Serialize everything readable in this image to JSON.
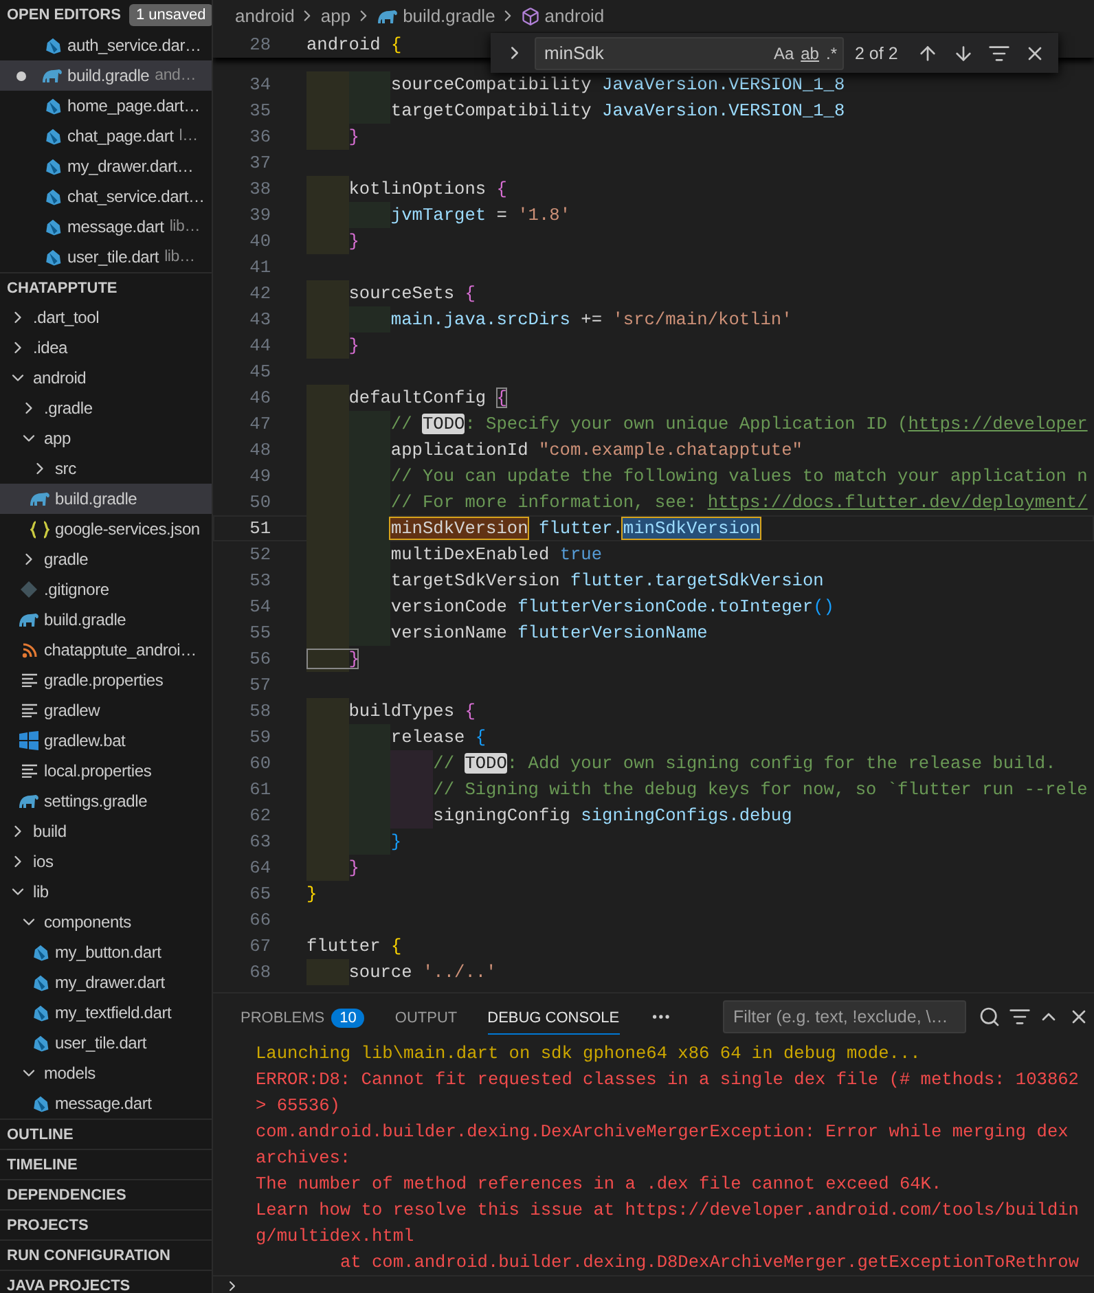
{
  "open_editors": {
    "title": "OPEN EDITORS",
    "badge": "1 unsaved",
    "items": [
      {
        "name": "auth_service.dar…",
        "kind": "dart",
        "selected": false,
        "unsaved": false
      },
      {
        "name": "build.gradle",
        "description": "and…",
        "kind": "gradle",
        "selected": true,
        "unsaved": true
      },
      {
        "name": "home_page.dart…",
        "kind": "dart",
        "selected": false,
        "unsaved": false
      },
      {
        "name": "chat_page.dart",
        "description": "l…",
        "kind": "dart",
        "selected": false,
        "unsaved": false
      },
      {
        "name": "my_drawer.dart…",
        "kind": "dart",
        "selected": false,
        "unsaved": false
      },
      {
        "name": "chat_service.dart…",
        "kind": "dart",
        "selected": false,
        "unsaved": false
      },
      {
        "name": "message.dart",
        "description": "lib…",
        "kind": "dart",
        "selected": false,
        "unsaved": false
      },
      {
        "name": "user_tile.dart",
        "description": "lib…",
        "kind": "dart",
        "selected": false,
        "unsaved": false
      }
    ]
  },
  "explorer": {
    "title": "CHATAPPTUTE",
    "tree": [
      {
        "name": ".dart_tool",
        "kind": "folder",
        "expanded": false,
        "selected": false
      },
      {
        "name": ".idea",
        "kind": "folder",
        "expanded": false,
        "selected": false
      },
      {
        "name": "android",
        "kind": "folder",
        "expanded": true,
        "selected": false,
        "children": [
          {
            "name": ".gradle",
            "kind": "folder",
            "expanded": false,
            "selected": false
          },
          {
            "name": "app",
            "kind": "folder",
            "expanded": true,
            "selected": false,
            "children": [
              {
                "name": "src",
                "kind": "folder",
                "expanded": false,
                "selected": false
              },
              {
                "name": "build.gradle",
                "kind": "gradle",
                "selected": true
              },
              {
                "name": "google-services.json",
                "kind": "json",
                "selected": false
              }
            ]
          },
          {
            "name": "gradle",
            "kind": "folder",
            "expanded": false,
            "selected": false
          },
          {
            "name": ".gitignore",
            "kind": "git",
            "selected": false
          },
          {
            "name": "build.gradle",
            "kind": "gradle",
            "selected": false
          },
          {
            "name": "chatapptute_androi…",
            "kind": "feed",
            "selected": false
          },
          {
            "name": "gradle.properties",
            "kind": "text",
            "selected": false
          },
          {
            "name": "gradlew",
            "kind": "text",
            "selected": false
          },
          {
            "name": "gradlew.bat",
            "kind": "windows",
            "selected": false
          },
          {
            "name": "local.properties",
            "kind": "text",
            "selected": false
          },
          {
            "name": "settings.gradle",
            "kind": "gradle",
            "selected": false
          }
        ]
      },
      {
        "name": "build",
        "kind": "folder",
        "expanded": false,
        "selected": false
      },
      {
        "name": "ios",
        "kind": "folder",
        "expanded": false,
        "selected": false
      },
      {
        "name": "lib",
        "kind": "folder",
        "expanded": true,
        "selected": false,
        "children": [
          {
            "name": "components",
            "kind": "folder",
            "expanded": true,
            "selected": false,
            "children": [
              {
                "name": "my_button.dart",
                "kind": "dart",
                "selected": false
              },
              {
                "name": "my_drawer.dart",
                "kind": "dart",
                "selected": false
              },
              {
                "name": "my_textfield.dart",
                "kind": "dart",
                "selected": false
              },
              {
                "name": "user_tile.dart",
                "kind": "dart",
                "selected": false
              }
            ]
          },
          {
            "name": "models",
            "kind": "folder",
            "expanded": true,
            "selected": false,
            "children": [
              {
                "name": "message.dart",
                "kind": "dart",
                "selected": false
              }
            ]
          }
        ]
      }
    ]
  },
  "sections": [
    "OUTLINE",
    "TIMELINE",
    "DEPENDENCIES",
    "PROJECTS",
    "RUN CONFIGURATION",
    "JAVA PROJECTS"
  ],
  "breadcrumb": [
    {
      "kind": "folder",
      "text": "android"
    },
    {
      "kind": "folder",
      "text": "app"
    },
    {
      "kind": "gradle",
      "text": "build.gradle"
    },
    {
      "kind": "module",
      "text": "android"
    }
  ],
  "find": {
    "value": "minSdk",
    "options": [
      "Aa",
      "ab",
      ".*"
    ],
    "count": "2 of 2"
  },
  "sticky": {
    "number": "28",
    "tokens": [
      {
        "kind": "plain",
        "text": "android "
      },
      {
        "kind": "brace1",
        "text": "{"
      }
    ]
  },
  "lines": [
    {
      "number": "34",
      "current": false,
      "tokens": [
        {
          "kind": "plain",
          "text": "        sourceCompatibility "
        },
        {
          "kind": "var",
          "text": "JavaVersion.VERSION_1_8"
        }
      ]
    },
    {
      "number": "35",
      "current": false,
      "tokens": [
        {
          "kind": "plain",
          "text": "        targetCompatibility "
        },
        {
          "kind": "var",
          "text": "JavaVersion.VERSION_1_8"
        }
      ]
    },
    {
      "number": "36",
      "current": false,
      "tokens": [
        {
          "kind": "brace2",
          "text": "    }"
        }
      ]
    },
    {
      "number": "37",
      "current": false
    },
    {
      "number": "38",
      "current": false,
      "tokens": [
        {
          "kind": "plain",
          "text": "    kotlinOptions "
        },
        {
          "kind": "brace2",
          "text": "{"
        }
      ]
    },
    {
      "number": "39",
      "current": false,
      "tokens": [
        {
          "kind": "var",
          "text": "        jvmTarget"
        },
        {
          "kind": "plain",
          "text": " = "
        },
        {
          "kind": "str",
          "text": "'1.8'"
        }
      ]
    },
    {
      "number": "40",
      "current": false,
      "tokens": [
        {
          "kind": "brace2",
          "text": "    }"
        }
      ]
    },
    {
      "number": "41",
      "current": false
    },
    {
      "number": "42",
      "current": false,
      "tokens": [
        {
          "kind": "plain",
          "text": "    sourceSets "
        },
        {
          "kind": "brace2",
          "text": "{"
        }
      ]
    },
    {
      "number": "43",
      "current": false,
      "tokens": [
        {
          "kind": "var",
          "text": "        main.java.srcDirs"
        },
        {
          "kind": "plain",
          "text": " += "
        },
        {
          "kind": "str",
          "text": "'src/main/kotlin'"
        }
      ]
    },
    {
      "number": "44",
      "current": false,
      "tokens": [
        {
          "kind": "brace2",
          "text": "    }"
        }
      ]
    },
    {
      "number": "45",
      "current": false
    },
    {
      "number": "46",
      "current": false,
      "tokens": [
        {
          "kind": "plain",
          "text": "    defaultConfig "
        },
        {
          "kind": "pair",
          "text": "{"
        }
      ]
    },
    {
      "number": "47",
      "current": false,
      "tokens": [
        {
          "kind": "comment",
          "text": "        // "
        },
        {
          "kind": "todo",
          "text": "TODO"
        },
        {
          "kind": "comment",
          "text": ": Specify your own unique Application ID ("
        },
        {
          "kind": "url",
          "text": "https://developer"
        }
      ]
    },
    {
      "number": "48",
      "current": false,
      "tokens": [
        {
          "kind": "plain",
          "text": "        applicationId "
        },
        {
          "kind": "str",
          "text": "\"com.example.chatapptute\""
        }
      ]
    },
    {
      "number": "49",
      "current": false,
      "tokens": [
        {
          "kind": "comment",
          "text": "        // You can update the following values to match your application n"
        }
      ]
    },
    {
      "number": "50",
      "current": false,
      "tokens": [
        {
          "kind": "comment",
          "text": "        // For more information, see: "
        },
        {
          "kind": "url",
          "text": "https://docs.flutter.dev/deployment/"
        }
      ]
    },
    {
      "number": "51",
      "current": true,
      "tokens": [
        {
          "kind": "match",
          "text": "        minSdkVersion"
        },
        {
          "kind": "var",
          "text": " flutter."
        },
        {
          "kind": "current-match",
          "text": "minSdkVersion"
        }
      ]
    },
    {
      "number": "52",
      "current": false,
      "tokens": [
        {
          "kind": "plain",
          "text": "        multiDexEnabled "
        },
        {
          "kind": "bool",
          "text": "true"
        }
      ]
    },
    {
      "number": "53",
      "current": false,
      "tokens": [
        {
          "kind": "plain",
          "text": "        targetSdkVersion "
        },
        {
          "kind": "var",
          "text": "flutter.targetSdkVersion"
        }
      ]
    },
    {
      "number": "54",
      "current": false,
      "tokens": [
        {
          "kind": "plain",
          "text": "        versionCode "
        },
        {
          "kind": "var",
          "text": "flutterVersionCode.toInteger"
        },
        {
          "kind": "brace3",
          "text": "()"
        }
      ]
    },
    {
      "number": "55",
      "current": false,
      "tokens": [
        {
          "kind": "plain",
          "text": "        versionName "
        },
        {
          "kind": "var",
          "text": "flutterVersionName"
        }
      ]
    },
    {
      "number": "56",
      "current": false,
      "tokens": [
        {
          "kind": "pair",
          "text": "    }"
        }
      ]
    },
    {
      "number": "57",
      "current": false
    },
    {
      "number": "58",
      "current": false,
      "tokens": [
        {
          "kind": "plain",
          "text": "    buildTypes "
        },
        {
          "kind": "brace2",
          "text": "{"
        }
      ]
    },
    {
      "number": "59",
      "current": false,
      "tokens": [
        {
          "kind": "plain",
          "text": "        release "
        },
        {
          "kind": "brace3",
          "text": "{"
        }
      ]
    },
    {
      "number": "60",
      "current": false,
      "tokens": [
        {
          "kind": "comment",
          "text": "            // "
        },
        {
          "kind": "todo",
          "text": "TODO"
        },
        {
          "kind": "comment",
          "text": ": Add your own signing config for the release build."
        }
      ]
    },
    {
      "number": "61",
      "current": false,
      "tokens": [
        {
          "kind": "comment",
          "text": "            // Signing with the debug keys for now, so `flutter run --rele"
        }
      ]
    },
    {
      "number": "62",
      "current": false,
      "tokens": [
        {
          "kind": "plain",
          "text": "            signingConfig "
        },
        {
          "kind": "var",
          "text": "signingConfigs.debug"
        }
      ]
    },
    {
      "number": "63",
      "current": false,
      "tokens": [
        {
          "kind": "brace3",
          "text": "        }"
        }
      ]
    },
    {
      "number": "64",
      "current": false,
      "tokens": [
        {
          "kind": "brace2",
          "text": "    }"
        }
      ]
    },
    {
      "number": "65",
      "current": false,
      "tokens": [
        {
          "kind": "brace1",
          "text": "}"
        }
      ]
    },
    {
      "number": "66",
      "current": false
    },
    {
      "number": "67",
      "current": false,
      "tokens": [
        {
          "kind": "plain",
          "text": "flutter "
        },
        {
          "kind": "brace1",
          "text": "{"
        }
      ]
    },
    {
      "number": "68",
      "current": false,
      "tokens": [
        {
          "kind": "plain",
          "text": "    source "
        },
        {
          "kind": "str",
          "text": "'../..'"
        }
      ]
    }
  ],
  "panel": {
    "tabs": [
      {
        "label": "PROBLEMS",
        "badge": "10",
        "selected": false
      },
      {
        "label": "OUTPUT",
        "selected": false
      },
      {
        "label": "DEBUG CONSOLE",
        "selected": true
      }
    ],
    "filter": {
      "placeholder": "Filter (e.g. text, !exclude, \\…"
    },
    "console": [
      {
        "kind": "info",
        "text": "Launching lib\\main.dart on sdk gphone64 x86 64 in debug mode..."
      },
      {
        "kind": "error",
        "text": "ERROR:D8: Cannot fit requested classes in a single dex file (# methods: 103862 > 65536)"
      },
      {
        "kind": "error",
        "text": "com.android.builder.dexing.DexArchiveMergerException: Error while merging dex archives:"
      },
      {
        "kind": "error",
        "text": "The number of method references in a .dex file cannot exceed 64K."
      },
      {
        "kind": "error",
        "text": "Learn how to resolve this issue at https://developer.android.com/tools/building/multidex.html"
      },
      {
        "kind": "error",
        "text": "        at com.android.builder.dexing.D8DexArchiveMerger.getExceptionToRethrow"
      }
    ]
  }
}
